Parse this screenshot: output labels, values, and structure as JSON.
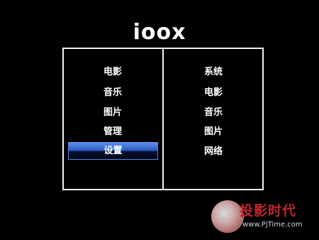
{
  "logo": {
    "text": "ioox"
  },
  "left_menu": {
    "items": [
      {
        "label": "电影"
      },
      {
        "label": "音乐"
      },
      {
        "label": "图片"
      },
      {
        "label": "管理"
      },
      {
        "label": "设置"
      }
    ],
    "selected_index": 4
  },
  "right_menu": {
    "items": [
      {
        "label": "系统"
      },
      {
        "label": "电影"
      },
      {
        "label": "音乐"
      },
      {
        "label": "图片"
      },
      {
        "label": "网络"
      }
    ]
  },
  "watermark": {
    "title": "投影时代",
    "url": "www.PjTime.com"
  },
  "colors": {
    "background": "#000000",
    "border": "#f2f2f2",
    "selection_top": "#5d8ee6",
    "selection_bottom": "#040818",
    "watermark_red": "#c0262c"
  }
}
